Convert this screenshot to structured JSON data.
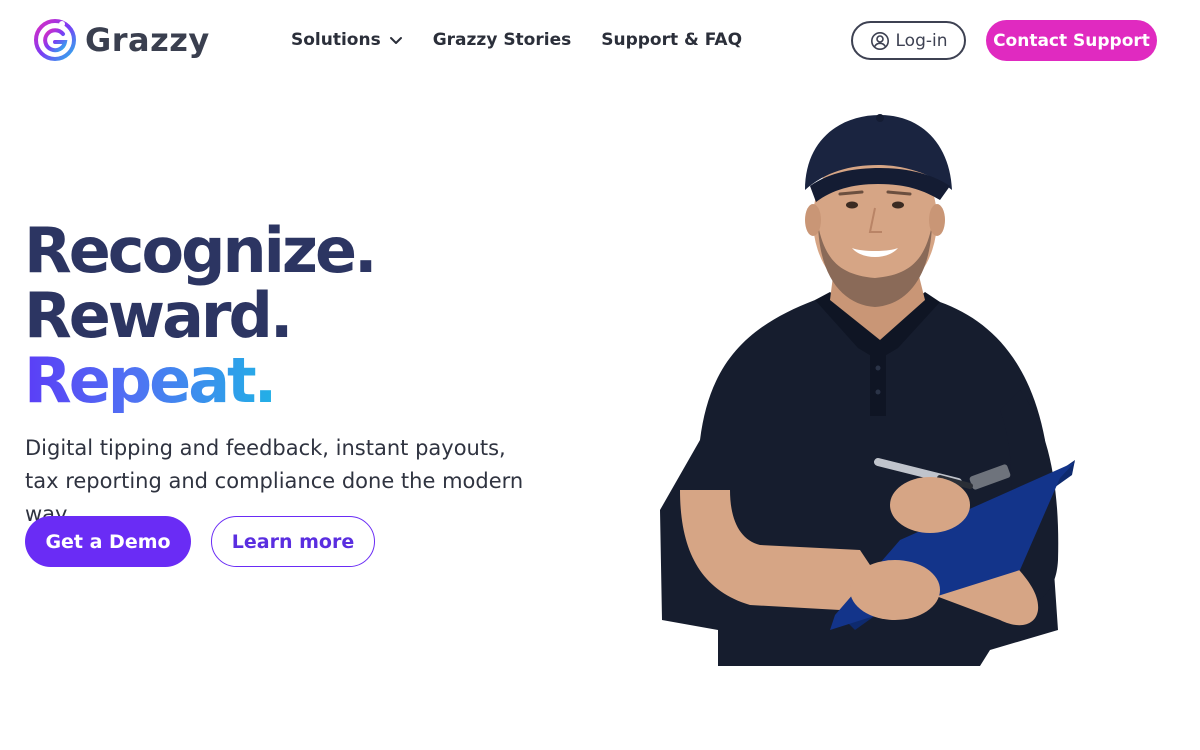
{
  "brand": {
    "name": "Grazzy",
    "logo_icon": "grazzy-logo-icon",
    "accent_colors": {
      "magenta": "#e02ac0",
      "purple": "#6a2cf5",
      "navy": "#2c3562",
      "cyan": "#22b0e6"
    }
  },
  "nav": {
    "items": [
      {
        "label": "Solutions",
        "has_dropdown": true
      },
      {
        "label": "Grazzy Stories"
      },
      {
        "label": "Support & FAQ"
      }
    ]
  },
  "header": {
    "login_label": "Log-in",
    "login_icon": "user-circle-icon",
    "contact_label": "Contact Support"
  },
  "hero": {
    "line1": "Recognize.",
    "line2": "Reward.",
    "line3": "Repeat.",
    "subtitle": "Digital tipping and feedback, instant payouts, tax reporting and compliance done the modern way.",
    "primary_cta": "Get a Demo",
    "secondary_cta": "Learn more",
    "image_subject": "delivery-worker-with-clipboard-photo"
  }
}
